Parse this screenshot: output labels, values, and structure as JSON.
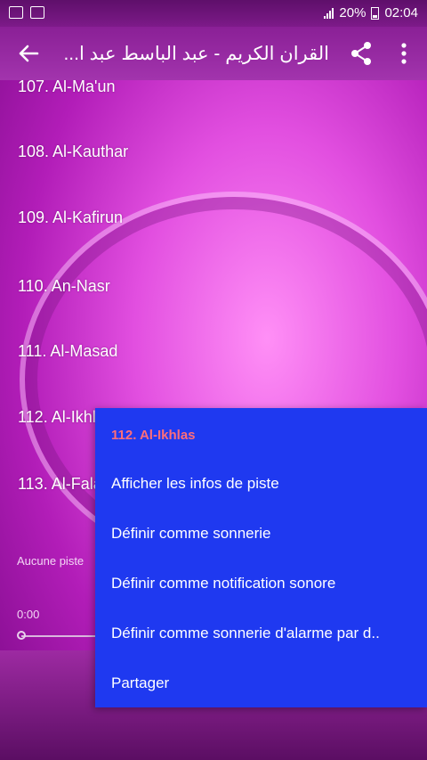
{
  "status_bar": {
    "battery": "20%",
    "time": "02:04"
  },
  "toolbar": {
    "title": "القران الكريم - عبد الباسط عبد ا..."
  },
  "tracks": [
    "107. Al-Ma'un",
    "108. Al-Kauthar",
    "109. Al-Kafirun",
    "110. An-Nasr",
    "111. Al-Masad",
    "112. Al-Ikhlas",
    "113. Al-Falaq"
  ],
  "player": {
    "now_playing": "Aucune piste",
    "elapsed": "0:00"
  },
  "context_menu": {
    "header": "112. Al-Ikhlas",
    "items": [
      "Afficher les infos de piste",
      "Définir comme sonnerie",
      "Définir comme notification sonore",
      "Définir comme sonnerie d'alarme par d..",
      "Partager"
    ]
  },
  "colors": {
    "menu_bg": "#1f39f0",
    "menu_header": "#ff6e7a",
    "toolbar": "#a234ad"
  }
}
